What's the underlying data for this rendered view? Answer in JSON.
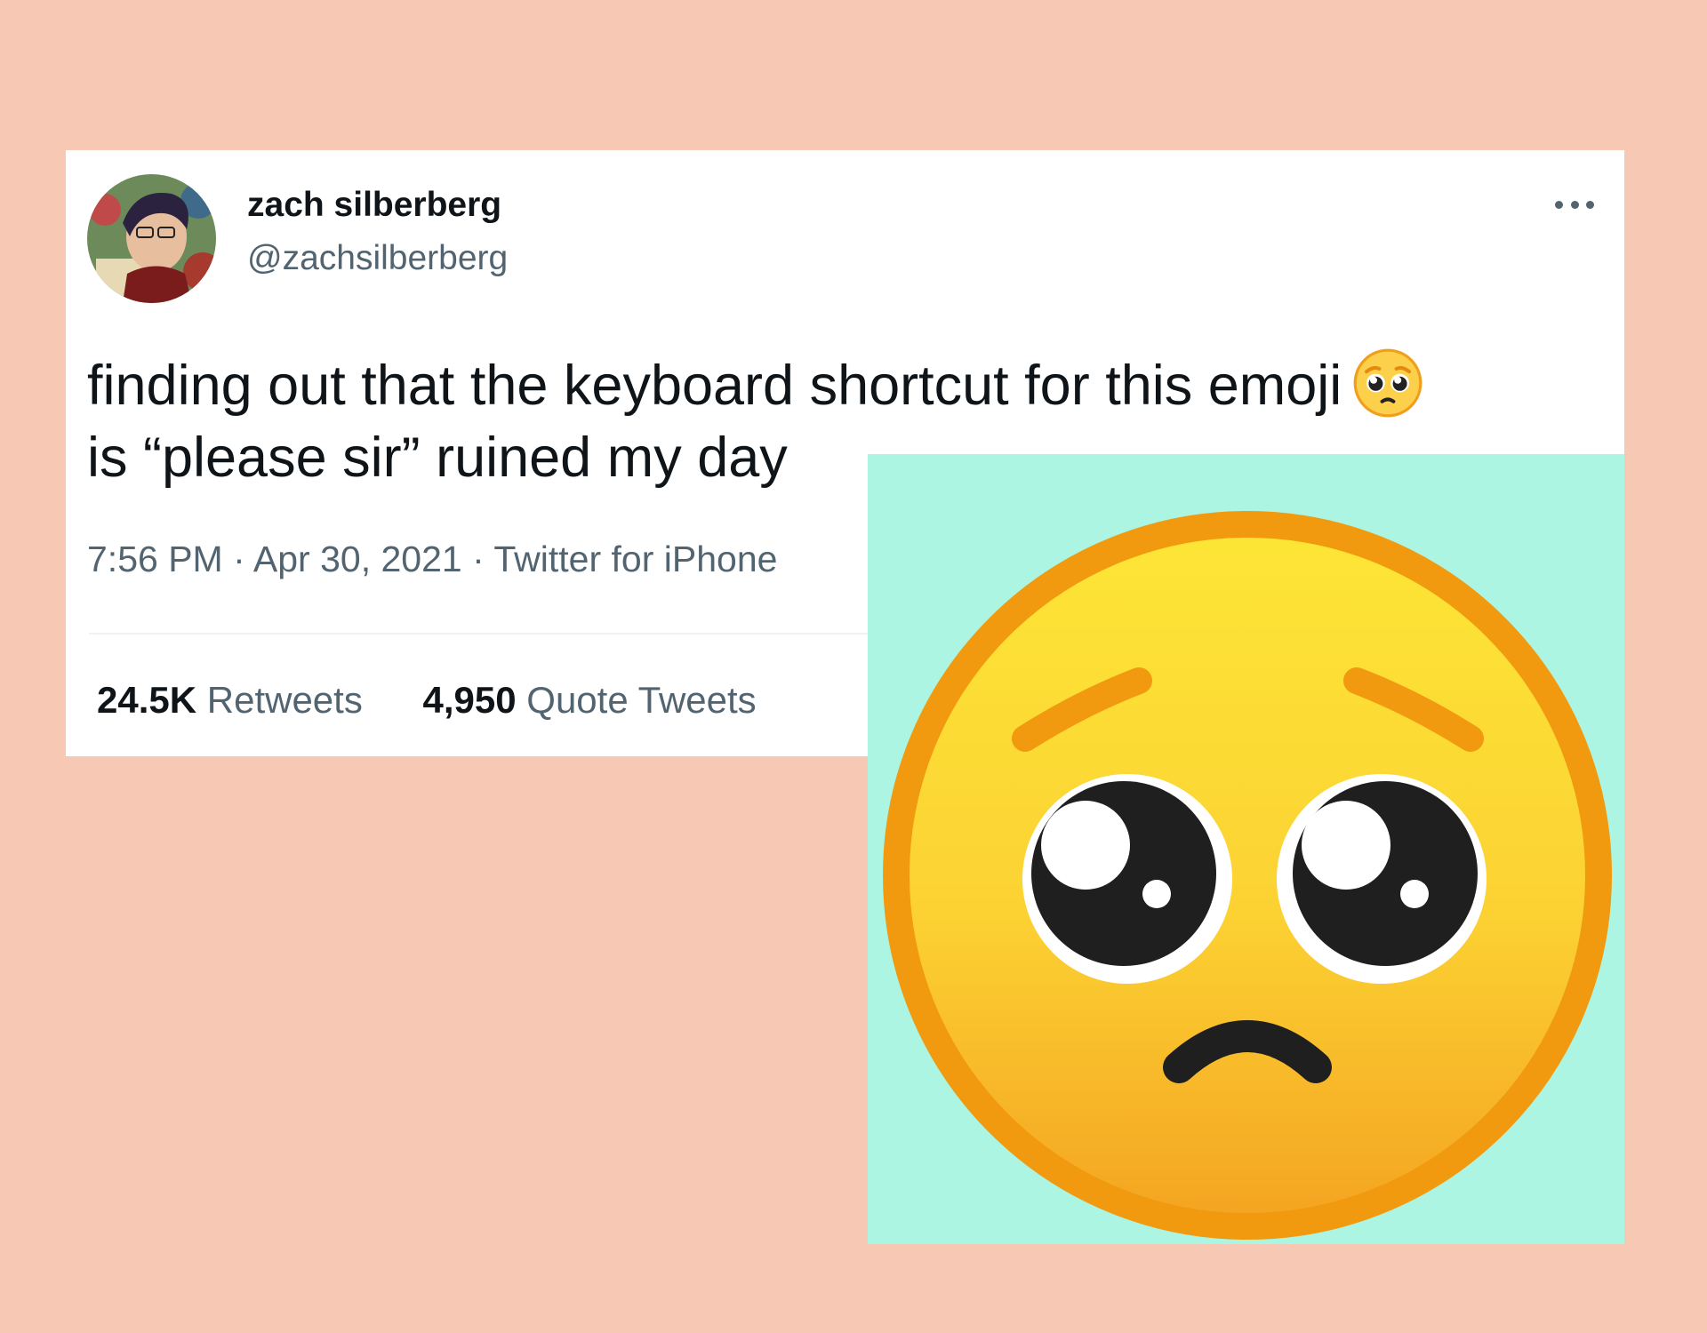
{
  "background_color": "#f7c8b4",
  "tweet": {
    "author": {
      "display_name": "zach silberberg",
      "handle": "@zachsilberberg",
      "avatar_icon": "profile-photo"
    },
    "text_line1": "finding out that the keyboard shortcut for this emoji",
    "text_line2": "is “please sir” ruined my day",
    "inline_emoji_icon": "pleading-face-emoji",
    "meta": {
      "time": "7:56 PM",
      "separator": " · ",
      "date": "Apr 30, 2021",
      "source": "Twitter for iPhone"
    },
    "stats": [
      {
        "count": "24.5K",
        "label": "Retweets"
      },
      {
        "count": "4,950",
        "label": "Quote Tweets"
      }
    ],
    "more_icon": "more-options-icon"
  },
  "emoji_panel": {
    "icon": "pleading-face-emoji",
    "background_color": "#acf5e3"
  }
}
